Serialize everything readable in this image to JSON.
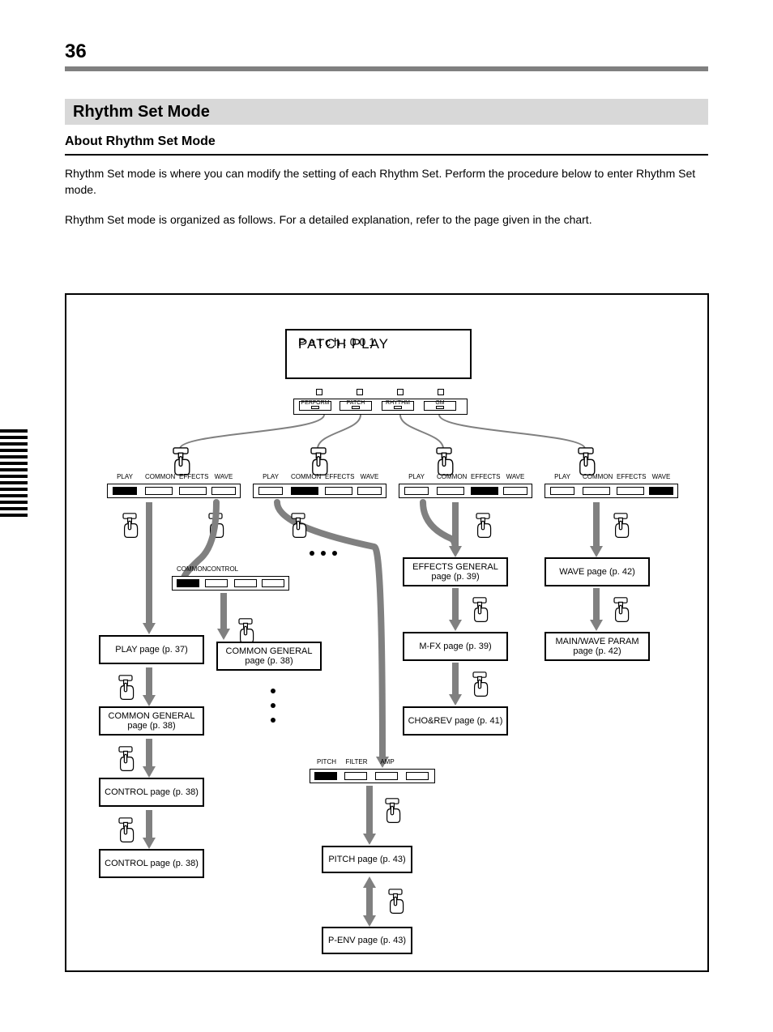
{
  "page_number": "36",
  "section_title": "Rhythm Set Mode",
  "sub_section_title": "About Rhythm Set Mode",
  "body_para_1": "Rhythm Set mode is where you can modify the setting of each Rhythm Set. Perform the procedure below to enter Rhythm Set mode.",
  "body_para_2": "Rhythm Set mode is organized as follows. For a detailed explanation, refer to the page given in the chart.",
  "main_display": {
    "line1": "PATCH PLAY",
    "line2": "Patch:001"
  },
  "below_display_labels": [
    "PERFORM",
    "PATCH",
    "RHYTHM",
    "GM"
  ],
  "strip_1": {
    "captions": [
      "PLAY",
      "COMMON",
      "EFFECTS",
      "WAVE"
    ],
    "active": 0
  },
  "strip_2": {
    "captions": [
      "PLAY",
      "COMMON",
      "EFFECTS",
      "WAVE"
    ],
    "active": 1
  },
  "strip_common2": {
    "captions": [
      "COMMON",
      "CONTROL",
      "",
      ""
    ],
    "active": 0
  },
  "strip_9": {
    "captions": [
      "PITCH",
      "FILTER",
      "AMP",
      ""
    ],
    "active": 0
  },
  "strip_3": {
    "captions": [
      "PLAY",
      "COMMON",
      "EFFECTS",
      "WAVE"
    ],
    "active": 2
  },
  "strip_4": {
    "captions": [
      "PLAY",
      "COMMON",
      "EFFECTS",
      "WAVE"
    ],
    "active": 3
  },
  "boxes": {
    "play_page": "PLAY page (p. 37)",
    "common_general": "COMMON GENERAL page (p. 38)",
    "common_ctrl": "CONTROL page (p. 38)",
    "common_general2": "COMMON GENERAL page (p. 38)",
    "control_page": "CONTROL page (p. 38)",
    "effects_general": "EFFECTS GENERAL page (p. 39)",
    "effects_mfx": "M-FX page (p. 39)",
    "effects_chorev": "CHO&REV page (p. 41)",
    "wave": "WAVE page (p. 42)",
    "wave_param": "MAIN/WAVE PARAM page (p. 42)",
    "pitch": "PITCH page (p. 43)",
    "p_env": "P-ENV page (p. 43)"
  }
}
